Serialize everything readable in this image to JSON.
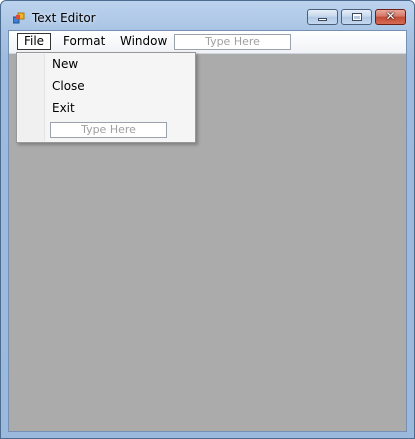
{
  "window": {
    "title": "Text Editor",
    "icon": "app-icon",
    "controls": {
      "minimize": "minimize-icon",
      "maximize": "maximize-icon",
      "close": "✕"
    }
  },
  "menubar": {
    "items": [
      {
        "label": "File"
      },
      {
        "label": "Format"
      },
      {
        "label": "Window"
      }
    ],
    "type_here": "Type Here"
  },
  "file_menu": {
    "items": [
      {
        "label": "New"
      },
      {
        "label": "Close"
      },
      {
        "label": "Exit"
      }
    ],
    "type_here": "Type Here"
  },
  "colors": {
    "client_area": "#ababab",
    "close_button": "#c24b36",
    "title_bar": "#a9c4e4"
  }
}
